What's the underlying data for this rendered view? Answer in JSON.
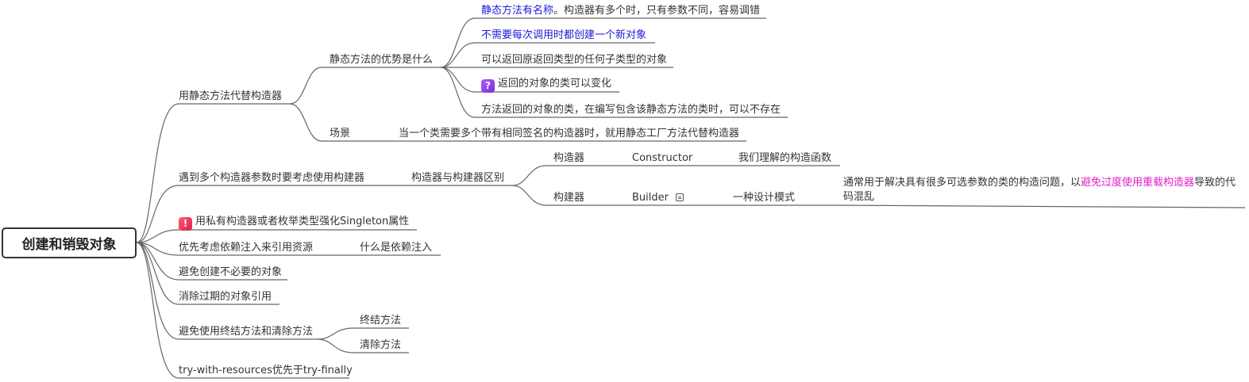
{
  "root": "创建和销毁对象",
  "branches": {
    "b1": "用静态方法代替构造器",
    "b1_1": "静态方法的优势是什么",
    "b1_1_items": {
      "a_blue": "静态方法有名称",
      "a_rest": "。构造器有多个时，只有参数不同，容易调错",
      "b": "不需要每次调用时都创建一个新对象",
      "c": "可以返回原返回类型的任何子类型的对象",
      "d_icon": "?",
      "d": "返回的对象的类可以变化",
      "e": "方法返回的对象的类，在编写包含该静态方法的类时，可以不存在"
    },
    "b1_2": "场景",
    "b1_2_item": "当一个类需要多个带有相同签名的构造器时，就用静态工厂方法代替构造器",
    "b2": "遇到多个构造器参数时要考虑使用构建器",
    "b2_1": "构造器与构建器区别",
    "b2_1_1": "构造器",
    "b2_1_1_a": "Constructor",
    "b2_1_1_b": "我们理解的构造函数",
    "b2_1_2": "构建器",
    "b2_1_2_a": "Builder",
    "b2_1_2_b": "一种设计模式",
    "b2_1_2_c_pre": "通常用于解决具有很多可选参数的类的构造问题，以",
    "b2_1_2_c_mag": "避免过度使用重载构造器",
    "b2_1_2_c_post": "导致的代码混乱",
    "b3_icon": "!",
    "b3": "用私有构造器或者枚举类型强化Singleton属性",
    "b4": "优先考虑依赖注入来引用资源",
    "b4_1": "什么是依赖注入",
    "b5": "避免创建不必要的对象",
    "b6": "消除过期的对象引用",
    "b7": "避免使用终结方法和清除方法",
    "b7_1": "终结方法",
    "b7_2": "清除方法",
    "b8": "try-with-resources优先于try-finally"
  },
  "colors": {
    "line": "#555555",
    "blue_text": "#1a1ad6",
    "magenta_text": "#e020c8"
  },
  "icons": [
    "question-badge-icon",
    "exclamation-badge-icon",
    "note-icon"
  ]
}
